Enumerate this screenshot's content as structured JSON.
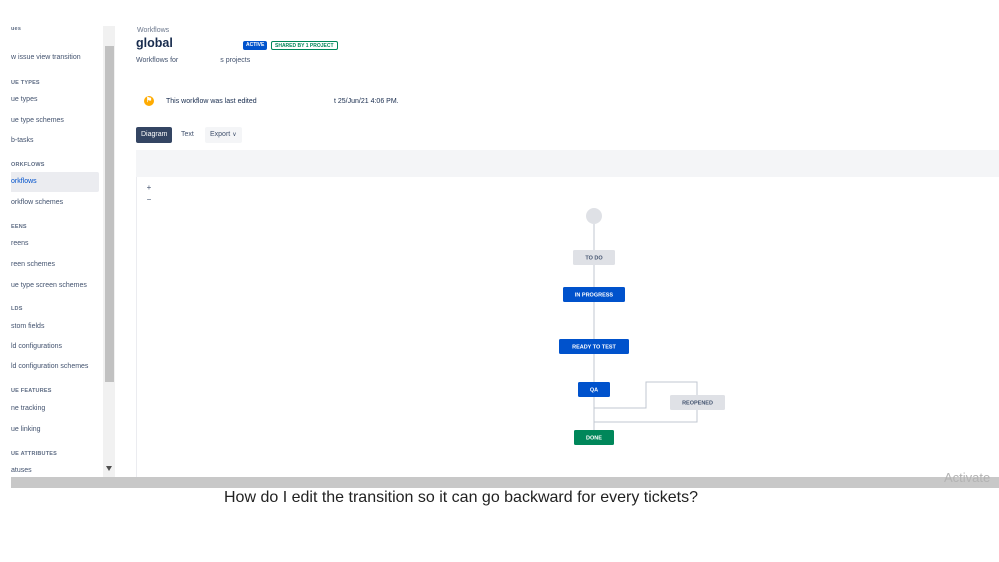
{
  "sidebar": {
    "items": [
      {
        "label": "ues",
        "type": "header"
      },
      {
        "label": "w issue view transition",
        "type": "link"
      },
      {
        "label": "UE TYPES",
        "type": "header"
      },
      {
        "label": "ue types",
        "type": "link"
      },
      {
        "label": "ue type schemes",
        "type": "link"
      },
      {
        "label": "b-tasks",
        "type": "link"
      },
      {
        "label": "ORKFLOWS",
        "type": "header"
      },
      {
        "label": "orkflows",
        "type": "link",
        "active": true
      },
      {
        "label": "orkflow schemes",
        "type": "link"
      },
      {
        "label": "EENS",
        "type": "header"
      },
      {
        "label": "reens",
        "type": "link"
      },
      {
        "label": "reen schemes",
        "type": "link"
      },
      {
        "label": "ue type screen schemes",
        "type": "link"
      },
      {
        "label": "LDS",
        "type": "header"
      },
      {
        "label": "stom fields",
        "type": "link"
      },
      {
        "label": "ld configurations",
        "type": "link"
      },
      {
        "label": "ld configuration schemes",
        "type": "link"
      },
      {
        "label": "UE FEATURES",
        "type": "header"
      },
      {
        "label": "ne tracking",
        "type": "link"
      },
      {
        "label": "ue linking",
        "type": "link"
      },
      {
        "label": "UE ATTRIBUTES",
        "type": "header"
      },
      {
        "label": "atuses",
        "type": "link"
      }
    ]
  },
  "header": {
    "breadcrumb": "Workflows",
    "title": "global",
    "status_lozenge": "ACTIVE",
    "shared_lozenge": "SHARED BY 1 PROJECT",
    "subtitle_left": "Workflows for",
    "subtitle_right": "s projects"
  },
  "notice": {
    "icon": "lock-icon",
    "icon_glyph": "⚑",
    "text": "This workflow was last edited",
    "date": "t 25/Jun/21 4:06 PM."
  },
  "tabs": {
    "diagram": "Diagram",
    "text": "Text",
    "export": "Export",
    "export_chevron": "∨"
  },
  "zoom": {
    "in": "+",
    "out": "−"
  },
  "diagram": {
    "colors": {
      "todo": "#dfe1e6",
      "inprogress": "#0052cc",
      "done": "#00875a",
      "line": "#c1c7d0",
      "start": "#dfe1e6"
    },
    "nodes": [
      {
        "id": "todo",
        "label": "TO DO",
        "category": "todo"
      },
      {
        "id": "inprogress",
        "label": "IN PROGRESS",
        "category": "inprogress"
      },
      {
        "id": "readytotest",
        "label": "READY TO TEST",
        "category": "inprogress"
      },
      {
        "id": "qa",
        "label": "QA",
        "category": "inprogress"
      },
      {
        "id": "reopened",
        "label": "REOPENED",
        "category": "todo"
      },
      {
        "id": "done",
        "label": "DONE",
        "category": "done"
      }
    ]
  },
  "overlay": {
    "watermark": "Activate",
    "question": "How do I edit the transition so it can go backward for every tickets?"
  }
}
